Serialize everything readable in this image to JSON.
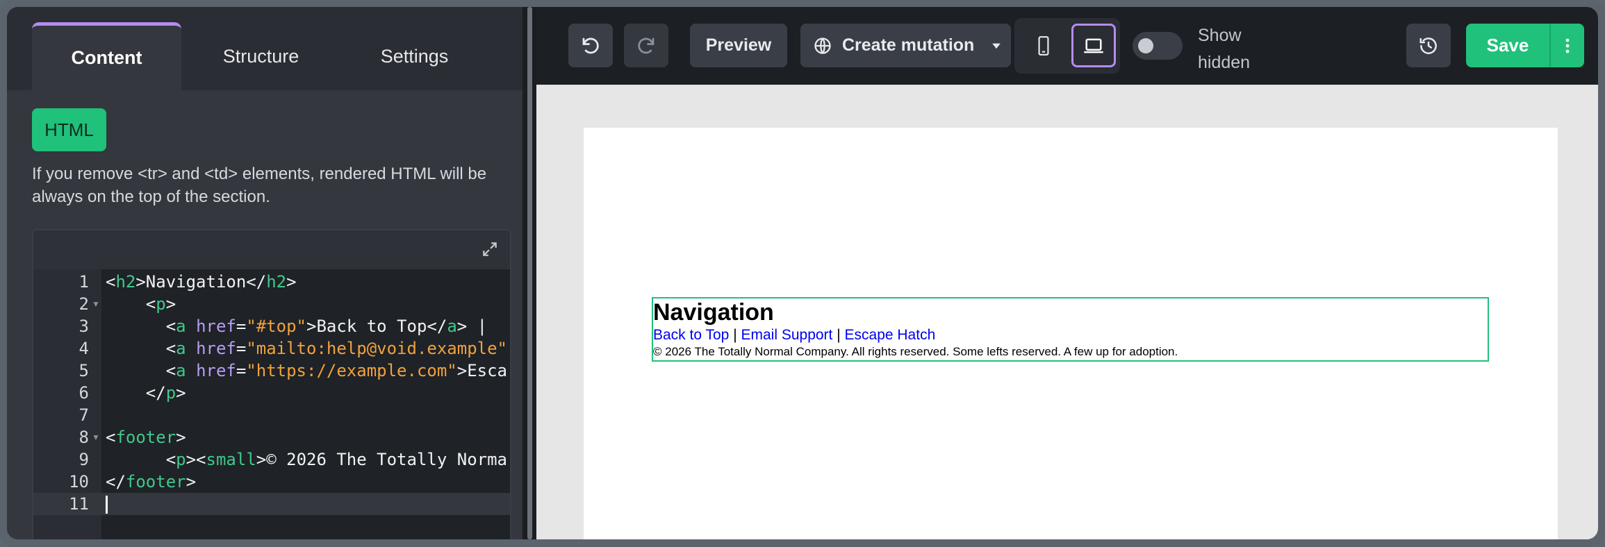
{
  "tabs": [
    {
      "label": "Content"
    },
    {
      "label": "Structure"
    },
    {
      "label": "Settings"
    }
  ],
  "html_block": {
    "badge": "HTML",
    "hint": "If you remove <tr> and <td> elements, rendered HTML will be always on the top of the section."
  },
  "editor": {
    "line_numbers": [
      "1",
      "2",
      "3",
      "4",
      "5",
      "6",
      "7",
      "8",
      "9",
      "10",
      "11"
    ],
    "lines": [
      {
        "indent": "",
        "parts": [
          [
            "p",
            "<"
          ],
          [
            "t",
            "h2"
          ],
          [
            "p",
            ">Navigation</"
          ],
          [
            "t",
            "h2"
          ],
          [
            "p",
            ">"
          ]
        ]
      },
      {
        "indent": "    ",
        "parts": [
          [
            "p",
            "<"
          ],
          [
            "t",
            "p"
          ],
          [
            "p",
            ">"
          ]
        ]
      },
      {
        "indent": "      ",
        "parts": [
          [
            "p",
            "<"
          ],
          [
            "t",
            "a"
          ],
          [
            "p",
            " "
          ],
          [
            "a",
            "href"
          ],
          [
            "p",
            "="
          ],
          [
            "s",
            "\"#top\""
          ],
          [
            "p",
            ">Back to Top</"
          ],
          [
            "t",
            "a"
          ],
          [
            "p",
            "> |"
          ]
        ]
      },
      {
        "indent": "      ",
        "parts": [
          [
            "p",
            "<"
          ],
          [
            "t",
            "a"
          ],
          [
            "p",
            " "
          ],
          [
            "a",
            "href"
          ],
          [
            "p",
            "="
          ],
          [
            "s",
            "\"mailto:help@void.example\""
          ]
        ]
      },
      {
        "indent": "      ",
        "parts": [
          [
            "p",
            "<"
          ],
          [
            "t",
            "a"
          ],
          [
            "p",
            " "
          ],
          [
            "a",
            "href"
          ],
          [
            "p",
            "="
          ],
          [
            "s",
            "\"https://example.com\""
          ],
          [
            "p",
            ">Esca"
          ]
        ]
      },
      {
        "indent": "    ",
        "parts": [
          [
            "p",
            "</"
          ],
          [
            "t",
            "p"
          ],
          [
            "p",
            ">"
          ]
        ]
      },
      {
        "indent": "",
        "parts": []
      },
      {
        "indent": "",
        "parts": [
          [
            "p",
            "<"
          ],
          [
            "t",
            "footer"
          ],
          [
            "p",
            ">"
          ]
        ]
      },
      {
        "indent": "      ",
        "parts": [
          [
            "p",
            "<"
          ],
          [
            "t",
            "p"
          ],
          [
            "p",
            "><"
          ],
          [
            "t",
            "small"
          ],
          [
            "p",
            ">© 2026 The Totally Norma"
          ]
        ]
      },
      {
        "indent": "",
        "parts": [
          [
            "p",
            "</"
          ],
          [
            "t",
            "footer"
          ],
          [
            "p",
            ">"
          ]
        ]
      },
      {
        "indent": "",
        "parts": []
      }
    ]
  },
  "toolbar": {
    "preview_label": "Preview",
    "mutation_label": "Create mutation",
    "toggle_label": "Show hidden",
    "save_label": "Save"
  },
  "preview": {
    "heading": "Navigation",
    "links": [
      "Back to Top",
      "Email Support",
      "Escape Hatch"
    ],
    "separator": " | ",
    "footer_text": "© 2026 The Totally Normal Company. All rights reserved. Some lefts reserved. A few up for adoption."
  },
  "colors": {
    "accent_green": "#1fc17b",
    "accent_purple": "#b58cf0"
  }
}
